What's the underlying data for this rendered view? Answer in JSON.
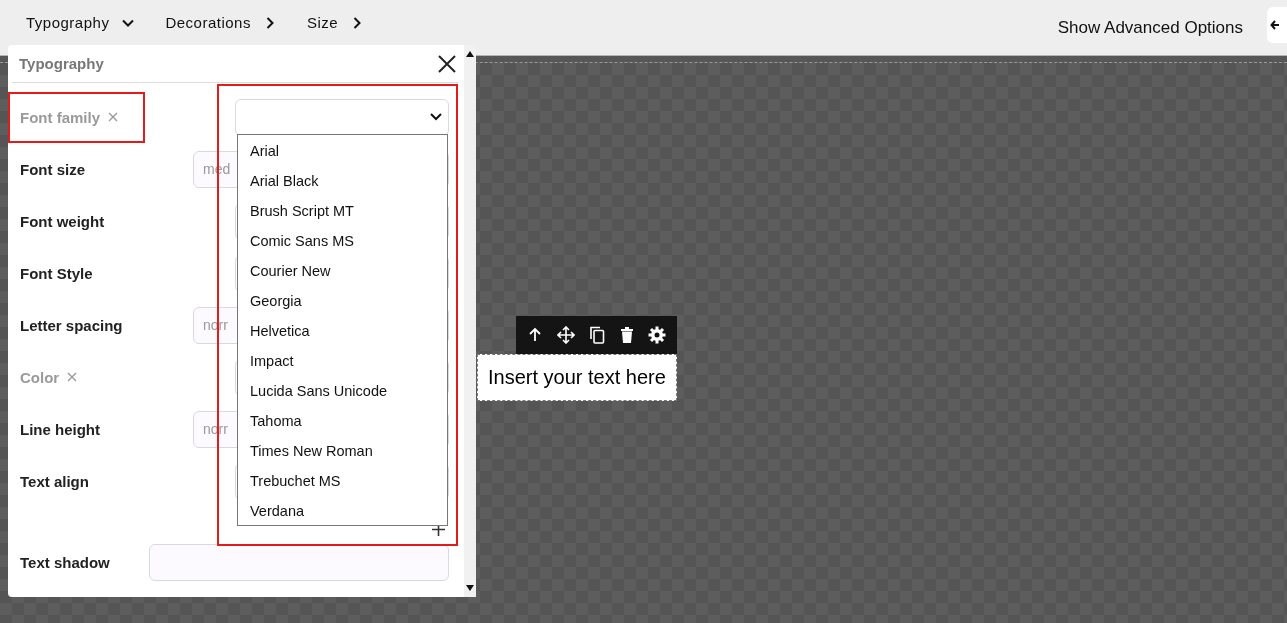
{
  "toolbar": {
    "tabs": [
      {
        "label": "Typography",
        "expanded": true
      },
      {
        "label": "Decorations",
        "expanded": false
      },
      {
        "label": "Size",
        "expanded": false
      }
    ],
    "advanced_button": "Show Advanced Options"
  },
  "panel": {
    "title": "Typography",
    "properties": [
      {
        "label": "Font family",
        "kind": "select",
        "removable": true,
        "highlighted": true
      },
      {
        "label": "Font size",
        "kind": "input",
        "placeholder": "med",
        "removable": false,
        "highlighted": false
      },
      {
        "label": "Font weight",
        "kind": "select",
        "removable": false,
        "highlighted": false
      },
      {
        "label": "Font Style",
        "kind": "select",
        "removable": false,
        "highlighted": false
      },
      {
        "label": "Letter spacing",
        "kind": "input",
        "placeholder": "norr",
        "removable": false,
        "highlighted": false
      },
      {
        "label": "Color",
        "kind": "color",
        "removable": true,
        "highlighted": false
      },
      {
        "label": "Line height",
        "kind": "input",
        "placeholder": "norr",
        "removable": false,
        "highlighted": false
      },
      {
        "label": "Text align",
        "kind": "radio",
        "removable": false,
        "highlighted": false
      },
      {
        "label": "Text shadow",
        "kind": "stack",
        "removable": false,
        "highlighted": false
      }
    ]
  },
  "dropdown": {
    "options": [
      "Arial",
      "Arial Black",
      "Brush Script MT",
      "Comic Sans MS",
      "Courier New",
      "Georgia",
      "Helvetica",
      "Impact",
      "Lucida Sans Unicode",
      "Tahoma",
      "Times New Roman",
      "Trebuchet MS",
      "Verdana"
    ]
  },
  "canvas": {
    "text_block": "Insert your text here"
  }
}
